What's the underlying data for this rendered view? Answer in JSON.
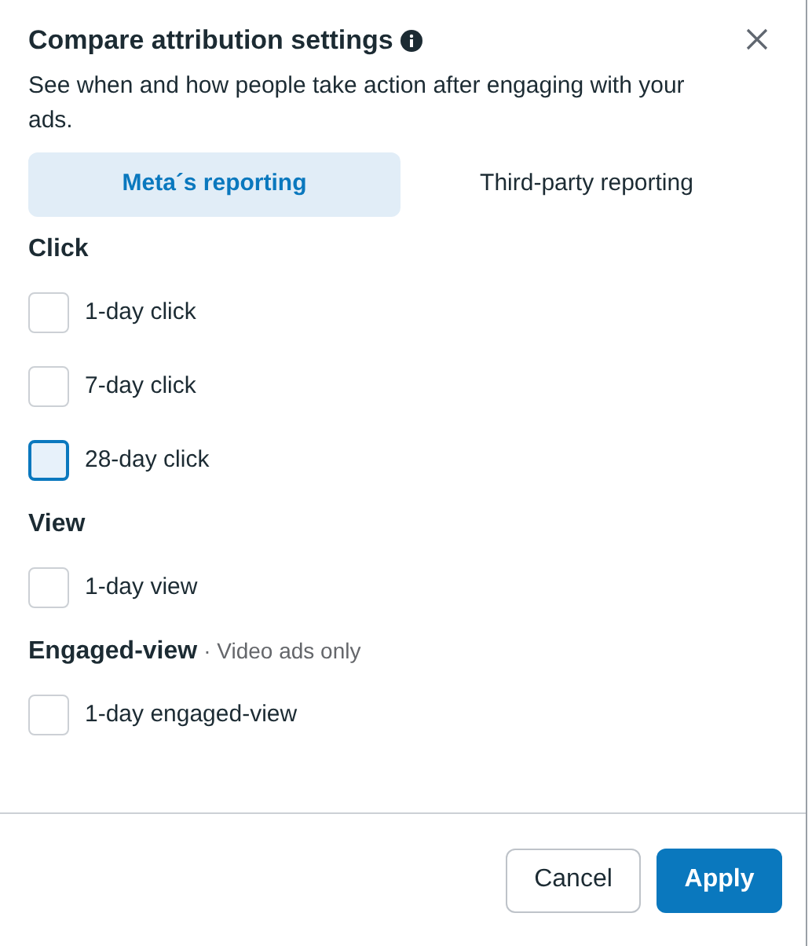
{
  "dialog": {
    "title": "Compare attribution settings",
    "description": "See when and how people take action after engaging with your ads."
  },
  "tabs": [
    {
      "label": "Meta´s reporting",
      "selected": true
    },
    {
      "label": "Third-party reporting",
      "selected": false
    }
  ],
  "groups": [
    {
      "heading": "Click",
      "options": [
        {
          "label": "1-day click",
          "checked": false,
          "focused": false
        },
        {
          "label": "7-day click",
          "checked": false,
          "focused": false
        },
        {
          "label": "28-day click",
          "checked": false,
          "focused": true
        }
      ]
    },
    {
      "heading": "View",
      "options": [
        {
          "label": "1-day view",
          "checked": false,
          "focused": false
        }
      ]
    },
    {
      "heading": "Engaged-view",
      "note": "· Video ads only",
      "options": [
        {
          "label": "1-day engaged-view",
          "checked": false,
          "focused": false
        }
      ]
    }
  ],
  "buttons": [
    {
      "label": "Cancel",
      "kind": "secondary"
    },
    {
      "label": "Apply",
      "kind": "primary"
    }
  ]
}
